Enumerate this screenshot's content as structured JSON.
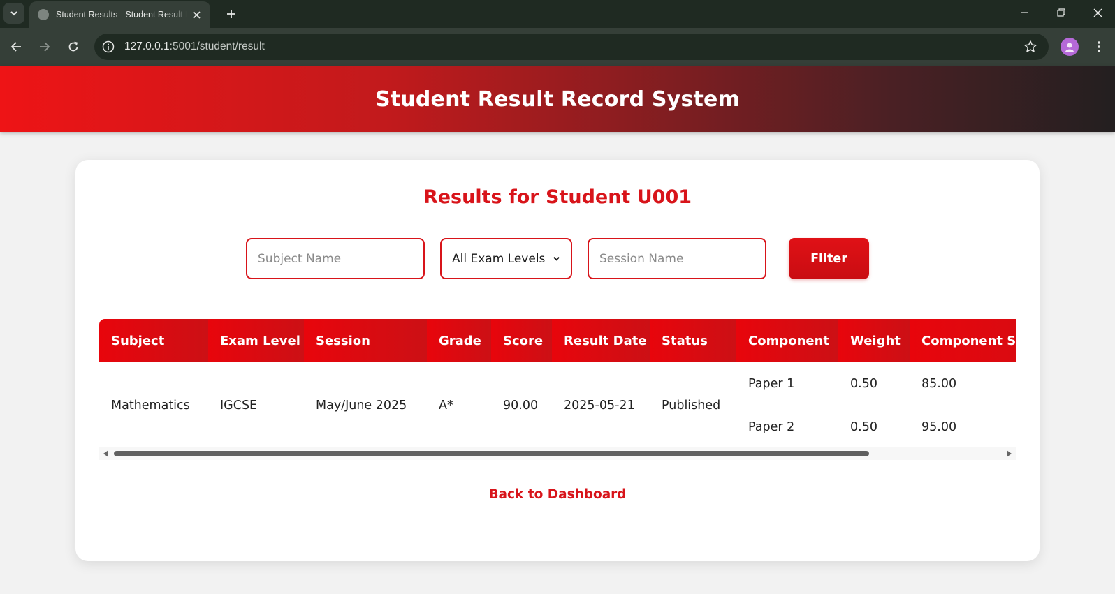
{
  "browser": {
    "tab_title": "Student Results - Student Result Record System",
    "url_host": "127.0.0.1",
    "url_path": ":5001/student/result"
  },
  "header": {
    "title": "Student Result Record System"
  },
  "main": {
    "heading": "Results for Student U001",
    "filters": {
      "subject_placeholder": "Subject Name",
      "exam_level_selected": "All Exam Levels",
      "session_placeholder": "Session Name",
      "filter_label": "Filter"
    },
    "table": {
      "columns": [
        "Subject",
        "Exam Level",
        "Session",
        "Grade",
        "Score",
        "Result Date",
        "Status",
        "Component",
        "Weight",
        "Component Score"
      ],
      "rows": [
        {
          "subject": "Mathematics",
          "exam_level": "IGCSE",
          "session": "May/June 2025",
          "grade": "A*",
          "score": "90.00",
          "result_date": "2025-05-21",
          "status": "Published",
          "components": [
            {
              "name": "Paper 1",
              "weight": "0.50",
              "score": "85.00"
            },
            {
              "name": "Paper 2",
              "weight": "0.50",
              "score": "95.00"
            }
          ]
        }
      ]
    },
    "back_link": "Back to Dashboard"
  },
  "colors": {
    "accent": "#d8141a",
    "header_gradient_start": "#ee1416",
    "header_gradient_end": "#231f20"
  }
}
